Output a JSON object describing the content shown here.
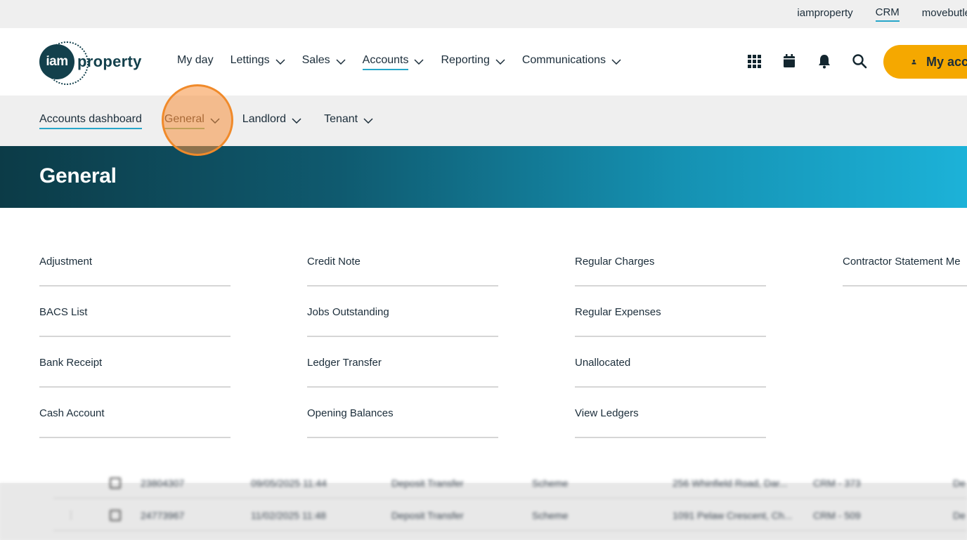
{
  "topbar": {
    "links": [
      {
        "label": "iamproperty",
        "active": false
      },
      {
        "label": "CRM",
        "active": true
      },
      {
        "label": "movebutler",
        "active": false
      }
    ]
  },
  "header": {
    "logo_circle": "iam",
    "logo_text": "property",
    "nav": [
      {
        "label": "My day",
        "has_menu": false
      },
      {
        "label": "Lettings",
        "has_menu": true
      },
      {
        "label": "Sales",
        "has_menu": true
      },
      {
        "label": "Accounts",
        "has_menu": true,
        "active": true
      },
      {
        "label": "Reporting",
        "has_menu": true
      },
      {
        "label": "Communications",
        "has_menu": true
      }
    ],
    "icons": [
      "apps-grid-icon",
      "calendar-icon",
      "bell-icon",
      "search-icon"
    ],
    "account_button": "My account",
    "accent": "#27a6c9",
    "button_color": "#f5a800"
  },
  "subnav": {
    "items": [
      {
        "label": "Accounts dashboard"
      },
      {
        "label": "General"
      },
      {
        "label": "Landlord"
      },
      {
        "label": "Tenant"
      }
    ]
  },
  "banner": {
    "title": "General"
  },
  "menu": {
    "columns": [
      [
        "Adjustment",
        "BACS List",
        "Bank Receipt",
        "Cash Account"
      ],
      [
        "Credit Note",
        "Jobs Outstanding",
        "Ledger Transfer",
        "Opening Balances"
      ],
      [
        "Regular Charges",
        "Regular Expenses",
        "Unallocated",
        "View Ledgers"
      ],
      [
        "Contractor Statement Me"
      ]
    ]
  },
  "background_table": {
    "rows": [
      {
        "id": "23804307",
        "date": "09/05/2025 11:44",
        "type": "Deposit Transfer",
        "source": "Scheme",
        "address": "256 Whinfield Road, Dar...",
        "ref": "CRM - 373",
        "extra": "De"
      },
      {
        "id": "24773967",
        "date": "11/02/2025 11:48",
        "type": "Deposit Transfer",
        "source": "Scheme",
        "address": "1091 Pelaw Crescent, Ch...",
        "ref": "CRM - 509",
        "extra": "De"
      }
    ]
  }
}
